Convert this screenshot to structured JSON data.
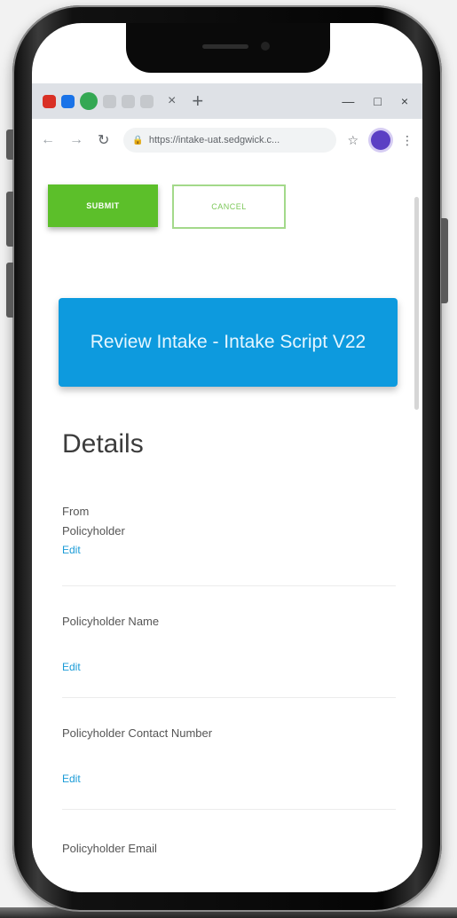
{
  "browser": {
    "url": "https://intake-uat.sedgwick.c...",
    "tab_close": "×",
    "tab_new": "+",
    "window_minimize": "—",
    "window_maximize": "□",
    "window_close": "×"
  },
  "actions": {
    "submit_label": "SUBMIT",
    "cancel_label": "CANCEL"
  },
  "banner": {
    "title": "Review Intake - Intake Script V22"
  },
  "details": {
    "title": "Details",
    "fields": [
      {
        "label": "From",
        "value": "Policyholder",
        "edit": "Edit"
      },
      {
        "label": "Policyholder Name",
        "value": "",
        "edit": "Edit"
      },
      {
        "label": "Policyholder Contact Number",
        "value": "",
        "edit": "Edit"
      },
      {
        "label": "Policyholder Email",
        "value": "",
        "edit": ""
      }
    ]
  },
  "colors": {
    "submit_green": "#5cbf2a",
    "banner_blue": "#0d9ade",
    "edit_link": "#1a9bd7"
  }
}
